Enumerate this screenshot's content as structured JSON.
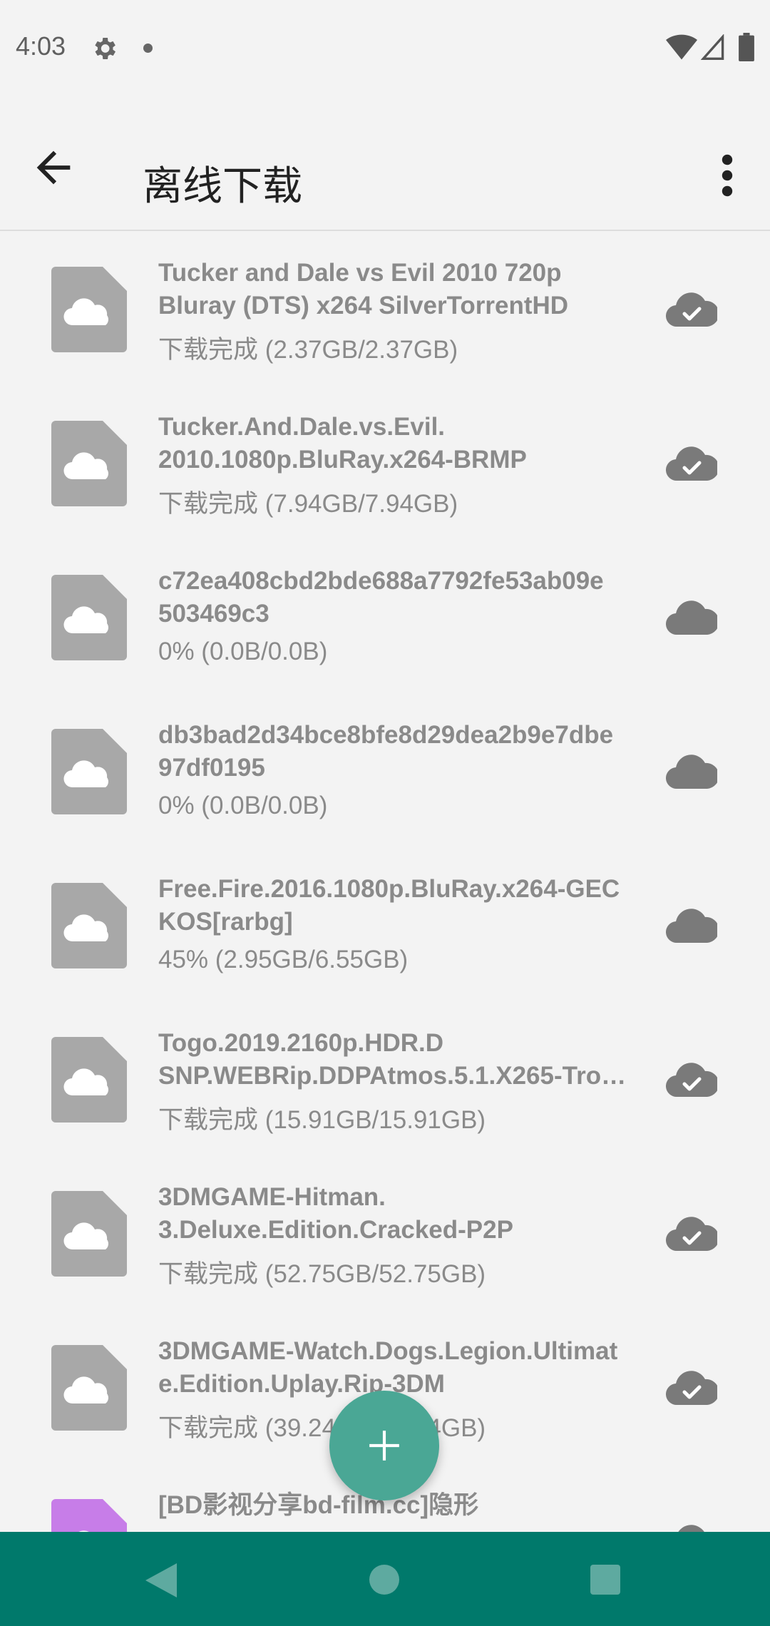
{
  "status_bar": {
    "time": "4:03"
  },
  "app_bar": {
    "title": "离线下载"
  },
  "items": [
    {
      "name_lines": [
        "Tucker and Dale vs Evil 2010 720p",
        "Bluray (DTS) x264 SilverTorrentHD"
      ],
      "status": "下载完成 (2.37GB/2.37GB)",
      "state": "done",
      "icon_color": "#a8a8a8"
    },
    {
      "name_lines": [
        "Tucker.And.Dale.vs.Evil.",
        "2010.1080p.BluRay.x264-BRMP"
      ],
      "status": "下载完成 (7.94GB/7.94GB)",
      "state": "done",
      "icon_color": "#a8a8a8"
    },
    {
      "name_lines": [
        "c72ea408cbd2bde688a7792fe53ab09e",
        "503469c3"
      ],
      "status": "0% (0.0B/0.0B)",
      "state": "pending",
      "icon_color": "#a8a8a8"
    },
    {
      "name_lines": [
        "db3bad2d34bce8bfe8d29dea2b9e7dbe",
        "97df0195"
      ],
      "status": "0% (0.0B/0.0B)",
      "state": "pending",
      "icon_color": "#a8a8a8"
    },
    {
      "name_lines": [
        "Free.Fire.2016.1080p.BluRay.x264-GEC",
        "KOS[rarbg]"
      ],
      "status": "45% (2.95GB/6.55GB)",
      "state": "pending",
      "icon_color": "#a8a8a8"
    },
    {
      "name_lines": [
        "Togo.2019.2160p.HDR.D",
        "SNP.WEBRip.DDPAtmos.5.1.X265-Tro…"
      ],
      "status": "下载完成 (15.91GB/15.91GB)",
      "state": "done",
      "icon_color": "#a8a8a8"
    },
    {
      "name_lines": [
        "3DMGAME-Hitman.",
        "3.Deluxe.Edition.Cracked-P2P"
      ],
      "status": "下载完成 (52.75GB/52.75GB)",
      "state": "done",
      "icon_color": "#a8a8a8"
    },
    {
      "name_lines": [
        "3DMGAME-Watch.Dogs.Legion.Ultimat",
        "e.Edition.Uplay.Rip-3DM"
      ],
      "status": "下载完成 (39.24GB/39.24GB)",
      "state": "done",
      "icon_color": "#a8a8a8"
    },
    {
      "name_lines": [
        "[BD影视分享bd-film.cc]隐形",
        ""
      ],
      "status": "",
      "state": "done",
      "icon_color": "#c77de8"
    }
  ],
  "colors": {
    "accent": "#4aa795",
    "nav_bar": "#00796b",
    "icon_gray": "#a8a8a8",
    "cloud": "#7a7a7a"
  },
  "icons": {
    "back": "arrow-left-icon",
    "more": "more-vert-icon",
    "fab": "plus-icon",
    "done": "cloud-done-icon",
    "pending": "cloud-icon"
  }
}
